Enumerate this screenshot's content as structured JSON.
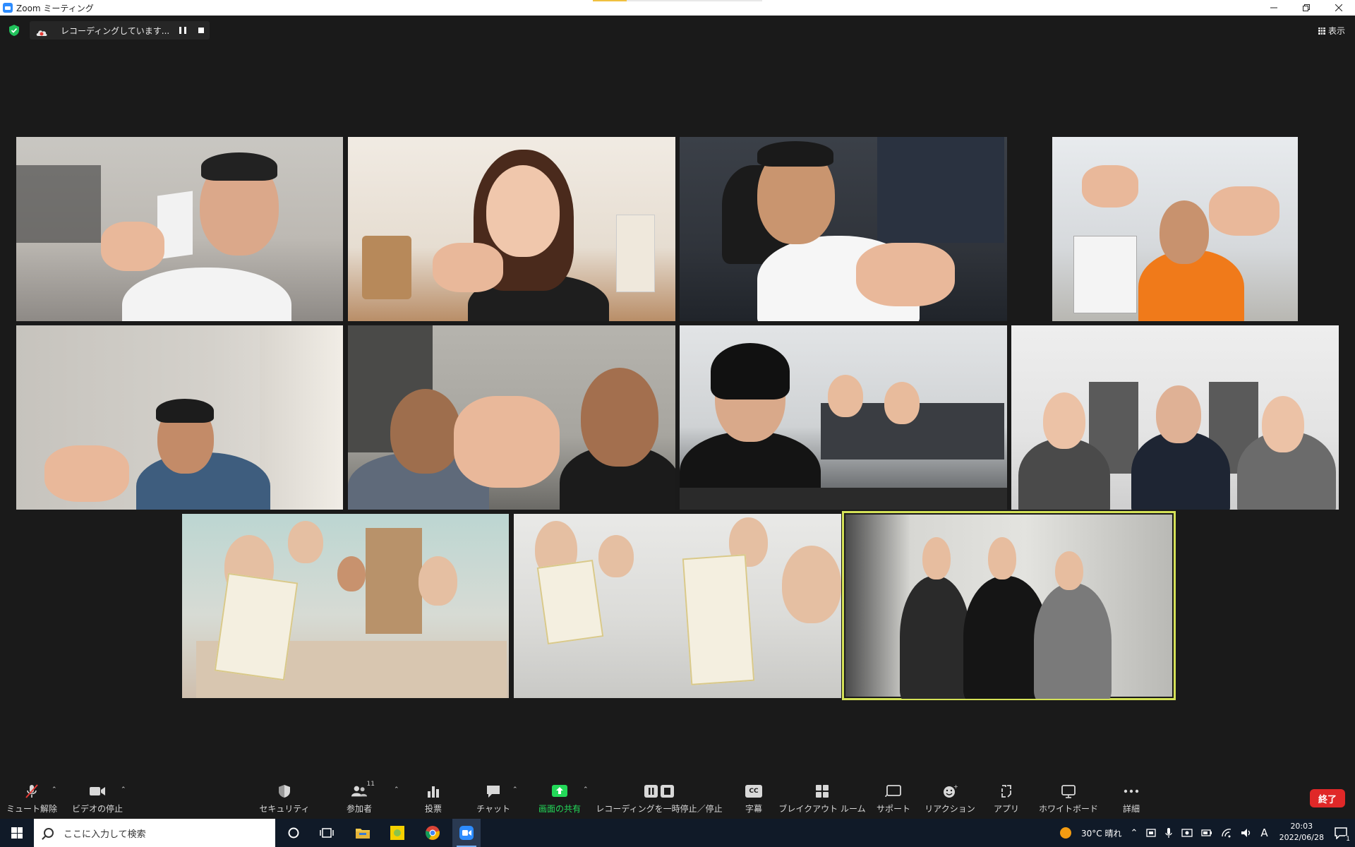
{
  "window": {
    "title": "Zoom ミーティング"
  },
  "recording": {
    "status": "レコーディングしています..."
  },
  "view": {
    "label": "表示"
  },
  "toolbar": {
    "mute": "ミュート解除",
    "video": "ビデオの停止",
    "security": "セキュリティ",
    "participants": "参加者",
    "participants_count": "11",
    "polls": "投票",
    "chat": "チャット",
    "share": "画面の共有",
    "record": "レコーディングを一時停止／停止",
    "captions": "字幕",
    "captions_icon": "CC",
    "breakout": "ブレイクアウト ルーム",
    "support": "サポート",
    "reactions": "リアクション",
    "apps": "アプリ",
    "whiteboard": "ホワイトボード",
    "more": "詳細",
    "end": "終了"
  },
  "taskbar": {
    "search_placeholder": "ここに入力して検索",
    "weather": "30°C 晴れ",
    "ime": "A",
    "time": "20:03",
    "date": "2022/06/28",
    "notification_count": "1"
  },
  "colors": {
    "accent_share": "#23d959",
    "active_speaker": "#d4e157",
    "end_button": "#e02828"
  }
}
